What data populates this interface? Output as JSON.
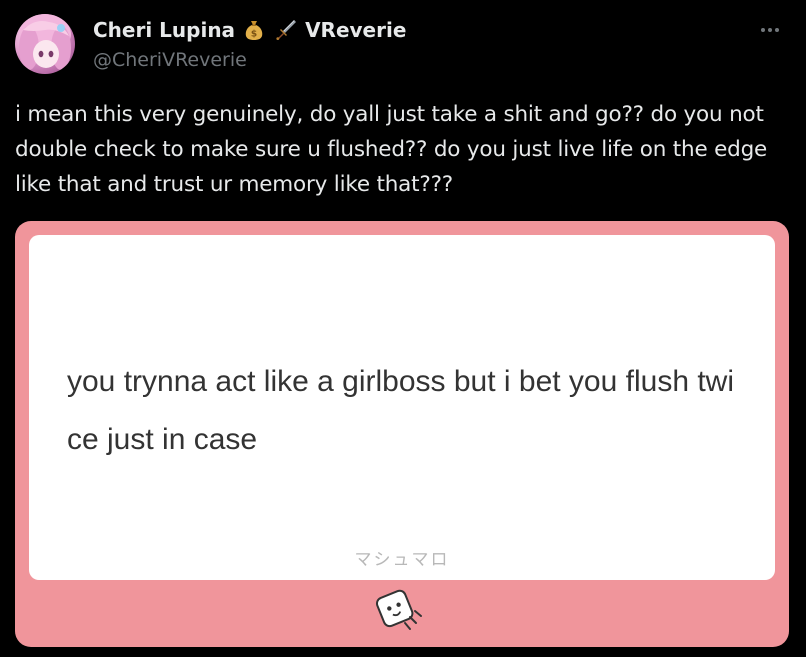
{
  "author": {
    "name": "Cheri Lupina",
    "emoji_1": "💰",
    "emoji_2": "🗡",
    "suffix": "VReverie",
    "handle": "@CheriVReverie"
  },
  "tweet": {
    "text": "i mean this very genuinely, do yall just take a shit and go?? do you not double check to make sure u flushed?? do you just live life on the edge like that and trust ur memory like that???"
  },
  "media": {
    "question": "you trynna act like a girlboss but i bet you flush twice just in case",
    "brand": "マシュマロ",
    "background_color": "#f0959b"
  },
  "icons": {
    "more": "more-dots-icon",
    "mascot": "marshmallow-mascot-icon",
    "money_bag": "money-bag-icon",
    "dagger": "dagger-icon"
  }
}
